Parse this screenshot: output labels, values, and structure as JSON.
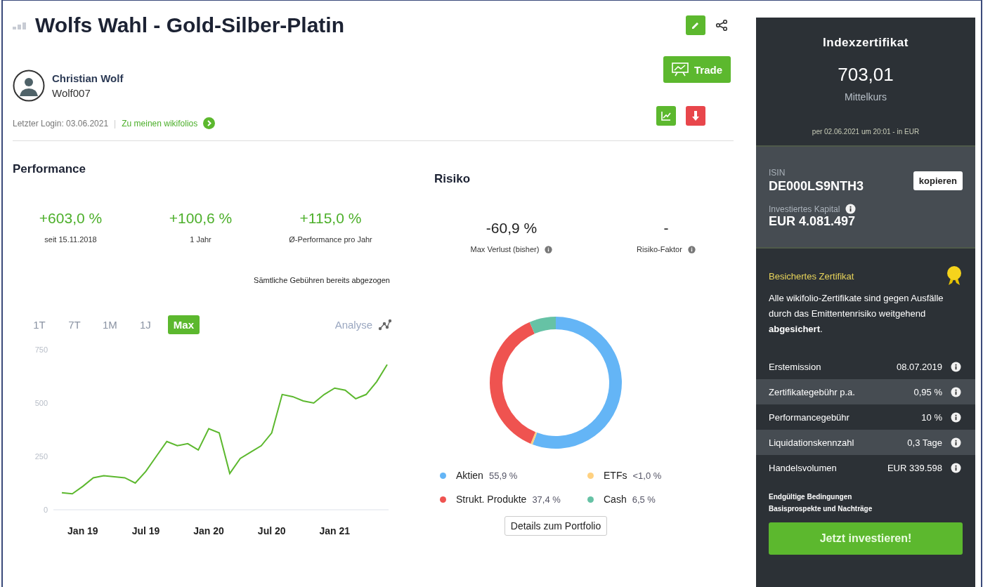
{
  "header": {
    "title": "Wolfs Wahl - Gold-Silber-Platin",
    "author_name": "Christian Wolf",
    "username": "Wolf007",
    "last_login": "Letzter Login: 03.06.2021",
    "separator": "|",
    "profile_link": "Zu meinen wikifolios",
    "trade_button": "Trade"
  },
  "performance": {
    "title": "Performance",
    "stats": [
      {
        "value": "+603,0 %",
        "label": "seit 15.11.2018"
      },
      {
        "value": "+100,6 %",
        "label": "1 Jahr"
      },
      {
        "value": "+115,0 %",
        "label": "Ø-Performance pro Jahr"
      }
    ],
    "note": "Sämtliche Gebühren bereits abgezogen"
  },
  "risk": {
    "title": "Risiko",
    "stats": [
      {
        "value": "-60,9 %",
        "label": "Max Verlust (bisher)"
      },
      {
        "value": "-",
        "label": "Risiko-Faktor"
      }
    ]
  },
  "price_chart": {
    "ranges": [
      {
        "label": "1T",
        "selected": false
      },
      {
        "label": "7T",
        "selected": false
      },
      {
        "label": "1M",
        "selected": false
      },
      {
        "label": "1J",
        "selected": false
      },
      {
        "label": "Max",
        "selected": true
      }
    ],
    "analyse": "Analyse",
    "chart_data": {
      "type": "line",
      "categories": [
        null,
        null,
        "Jan 19",
        null,
        null,
        null,
        null,
        null,
        "Jul 19",
        null,
        null,
        null,
        null,
        null,
        "Jan 20",
        null,
        null,
        null,
        null,
        null,
        "Jul 20",
        null,
        null,
        null,
        null,
        null,
        "Jan 21",
        null,
        null,
        null,
        null,
        null
      ],
      "ylim": [
        0,
        750
      ],
      "yticks": [
        0,
        250,
        500,
        750
      ],
      "series": [
        {
          "color": "#5cb82e",
          "values": [
            80,
            75,
            110,
            150,
            160,
            155,
            150,
            125,
            180,
            250,
            320,
            300,
            310,
            280,
            380,
            360,
            170,
            240,
            270,
            300,
            360,
            540,
            530,
            510,
            500,
            540,
            570,
            560,
            520,
            540,
            600,
            680
          ]
        }
      ]
    }
  },
  "portfolio": {
    "chart_data": {
      "type": "donut",
      "categories": [
        "Aktien",
        "ETFs",
        "Strukt. Produkte",
        "Cash"
      ],
      "values": [
        55.9,
        0.5,
        37.4,
        6.5
      ]
    },
    "legend": [
      {
        "value": "55,9 %",
        "color": "#64b5f6"
      },
      {
        "value": "<1,0 %",
        "color": "#ffd180"
      },
      {
        "value": "37,4 %",
        "color": "#ef5350"
      },
      {
        "value": "6,5 %",
        "color": "#66c2a5"
      }
    ],
    "details_button": "Details zum Portfolio"
  },
  "certificate": {
    "title": "Indexzertifikat",
    "price": "703,01",
    "price_label": "Mittelkurs",
    "timestamp": "per 02.06.2021 um 20:01 - in EUR",
    "isin_label": "ISIN",
    "isin": "DE000LS9NTH3",
    "copy_button": "kopieren",
    "capital_label": "Investiertes Kapital",
    "capital": "EUR 4.081.497",
    "secured_title": "Besichertes Zertifikat",
    "secured_text": "Alle wikifolio-Zertifikate sind gegen Ausfälle durch das Emittentenrisiko weitgehend **abgesichert**.",
    "facts": [
      {
        "label": "Erstemission",
        "value": "08.07.2019"
      },
      {
        "label": "Zertifikategebühr p.a.",
        "value": "0,95 %"
      },
      {
        "label": "Performancegebühr",
        "value": "10 %"
      },
      {
        "label": "Liquidationskennzahl",
        "value": "0,3 Tage"
      },
      {
        "label": "Handelsvolumen",
        "value": "EUR 339.598"
      }
    ],
    "links": [
      "Endgültige Bedingungen",
      "Basisprospekte und Nachträge"
    ],
    "invest_button": "Jetzt investieren!"
  }
}
